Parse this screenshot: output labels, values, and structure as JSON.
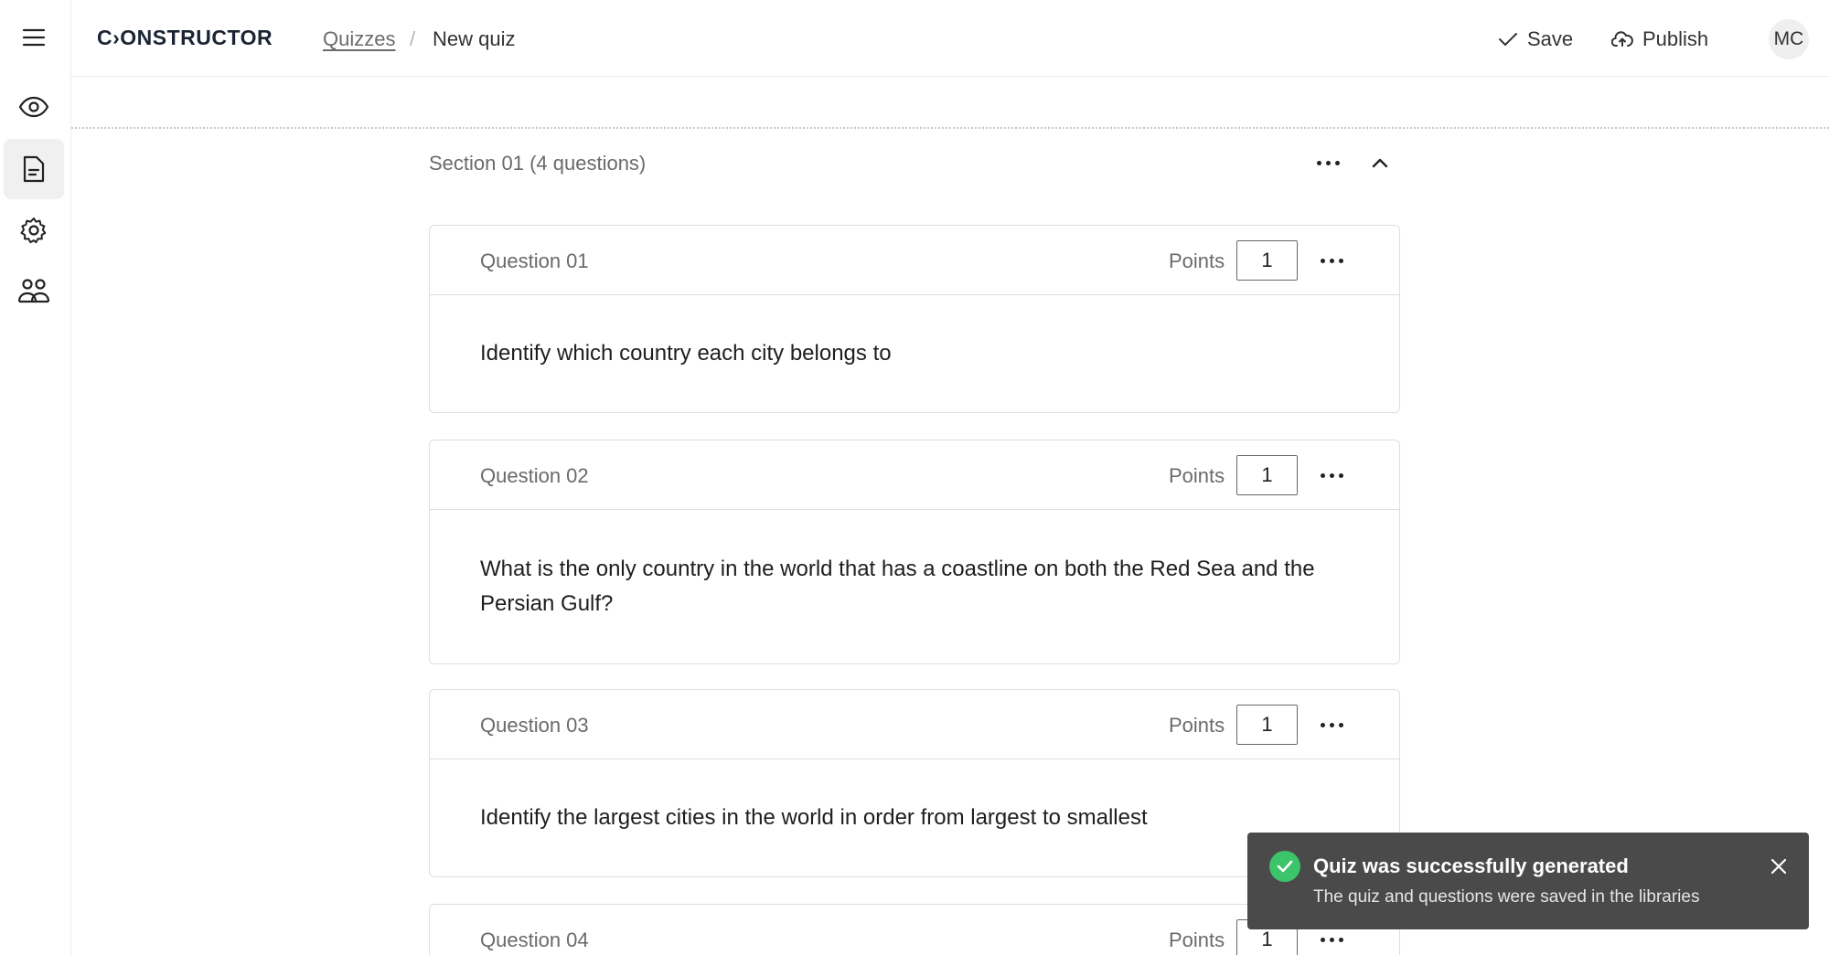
{
  "brand": {
    "logo_text": "C›ONSTRUCTOR"
  },
  "breadcrumb": {
    "parent": "Quizzes",
    "separator": "/",
    "current": "New quiz"
  },
  "header_actions": {
    "save_label": "Save",
    "publish_label": "Publish",
    "avatar_initials": "MC"
  },
  "rail": {
    "items": [
      "eye-icon",
      "document-icon",
      "gear-icon",
      "users-icon"
    ],
    "active": "document-icon"
  },
  "section": {
    "title": "Section 01 (4 questions)"
  },
  "points_label": "Points",
  "questions": [
    {
      "label": "Question 01",
      "points": "1",
      "text": "Identify which country each city belongs to"
    },
    {
      "label": "Question 02",
      "points": "1",
      "text": "What is the only country in the world that has a coastline on both the Red Sea and the Persian Gulf?"
    },
    {
      "label": "Question 03",
      "points": "1",
      "text": "Identify the largest cities in the world in order from largest to smallest"
    },
    {
      "label": "Question 04",
      "points": "1",
      "text": ""
    }
  ],
  "toast": {
    "title": "Quiz was successfully generated",
    "message": "The quiz and questions were saved in the libraries",
    "status_color": "#3cc46a"
  }
}
